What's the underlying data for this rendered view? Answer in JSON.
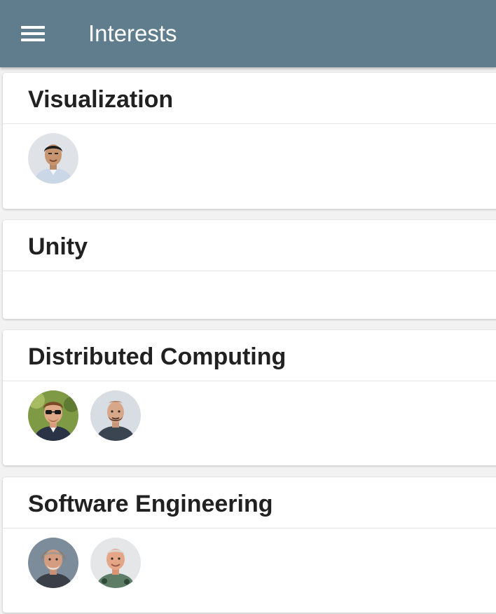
{
  "app_bar": {
    "title": "Interests",
    "menu_icon": "menu-icon",
    "color": "#5f7d8c"
  },
  "cards": [
    {
      "title": "Visualization",
      "avatars": [
        "avatar-person-1"
      ]
    },
    {
      "title": "Unity",
      "avatars": []
    },
    {
      "title": "Distributed Computing",
      "avatars": [
        "avatar-person-2",
        "avatar-person-3"
      ]
    },
    {
      "title": "Software Engineering",
      "avatars": [
        "avatar-person-4",
        "avatar-person-5"
      ]
    }
  ]
}
